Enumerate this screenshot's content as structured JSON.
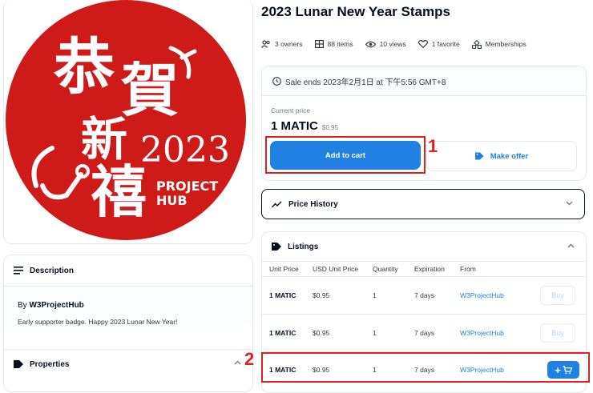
{
  "nft": {
    "title": "2023 Lunar New Year Stamps",
    "image": {
      "chars": [
        "恭",
        "賀",
        "新",
        "禧"
      ],
      "year": "2023",
      "badge_line1": "PROJECT",
      "badge_line2": "HUB",
      "color": "#cf1a1a"
    }
  },
  "stats": {
    "owners": "3 owners",
    "items": "88 items",
    "views": "10 views",
    "favorite": "1 favorite",
    "memberships": "Memberships"
  },
  "sale": {
    "ends": "Sale ends 2023年2月1日 at 下午5:56 GMT+8",
    "current_price_label": "Current price",
    "price": "1 MATIC",
    "price_usd": "$0.95",
    "add_to_cart": "Add to cart",
    "make_offer": "Make offer"
  },
  "price_history": {
    "label": "Price History"
  },
  "listings": {
    "label": "Listings",
    "columns": [
      "Unit Price",
      "USD Unit Price",
      "Quantity",
      "Expiration",
      "From"
    ],
    "rows": [
      {
        "price": "1 MATIC",
        "usd": "$0.95",
        "qty": "1",
        "exp": "7 days",
        "from": "W3ProjectHub",
        "action": "Buy"
      },
      {
        "price": "1 MATIC",
        "usd": "$0.95",
        "qty": "1",
        "exp": "7 days",
        "from": "W3ProjectHub",
        "action": "Buy"
      },
      {
        "price": "1 MATIC",
        "usd": "$0.95",
        "qty": "1",
        "exp": "7 days",
        "from": "W3ProjectHub",
        "action": "+"
      }
    ]
  },
  "description": {
    "label": "Description",
    "by_prefix": "By",
    "creator": "W3ProjectHub",
    "text": "Early supporter badge. Happy 2023 Lunar New Year!"
  },
  "properties": {
    "label": "Properties"
  },
  "annotations": {
    "one": "1",
    "two": "2",
    "color": "#e01f1f"
  },
  "colors": {
    "accent": "#2081e2",
    "text": "#04111d",
    "muted": "#707a83",
    "border": "#e5e8eb"
  }
}
